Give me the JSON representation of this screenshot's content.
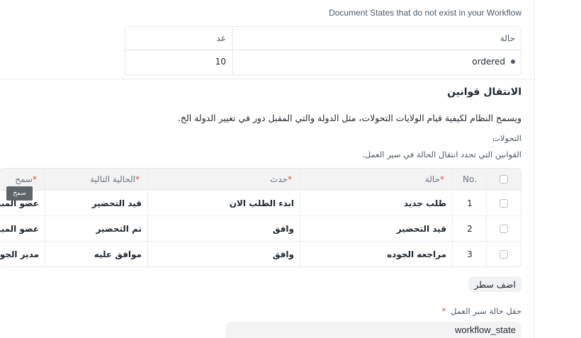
{
  "missing_states": {
    "notice": "Document States that do not exist in your Workflow",
    "headers": {
      "state": "حالة",
      "count": "عد"
    },
    "rows": [
      {
        "state": "ordered",
        "count": "10"
      }
    ]
  },
  "transitions_section": {
    "title": "الانتقال قوانين",
    "description": "ويسمح النظام لكيفية قيام الولايات التحولات، مثل الدولة والتي المقبل دور في تغيير الدولة الخ.",
    "field_label": "التحولات",
    "field_description": "القوانين التي تحدد انتقال الحالة في سير العمل."
  },
  "grid": {
    "headers": {
      "no": "No.",
      "state": "حالة",
      "action": "حدث",
      "next_state": "الحالية التالية",
      "allowed": "سمح"
    },
    "rows": [
      {
        "no": "1",
        "state": "طلب جديد",
        "action": "ابدء الطلب الان",
        "next_state": "قيد التحضير",
        "allowed": "عضو المبيعات"
      },
      {
        "no": "2",
        "state": "قيد التحضير",
        "action": "وافق",
        "next_state": "تم التحضير",
        "allowed": "عضو المبيعات"
      },
      {
        "no": "3",
        "state": "مراجعه الجوده",
        "action": "وافق",
        "next_state": "موافق عليه",
        "allowed": "مدير الجودة"
      }
    ],
    "required_mark": "*",
    "tooltip": "سمح"
  },
  "add_row_label": "اضف سطر",
  "workflow_state_field": {
    "label": "حقل حالة سير العمل",
    "value": "workflow_state"
  }
}
